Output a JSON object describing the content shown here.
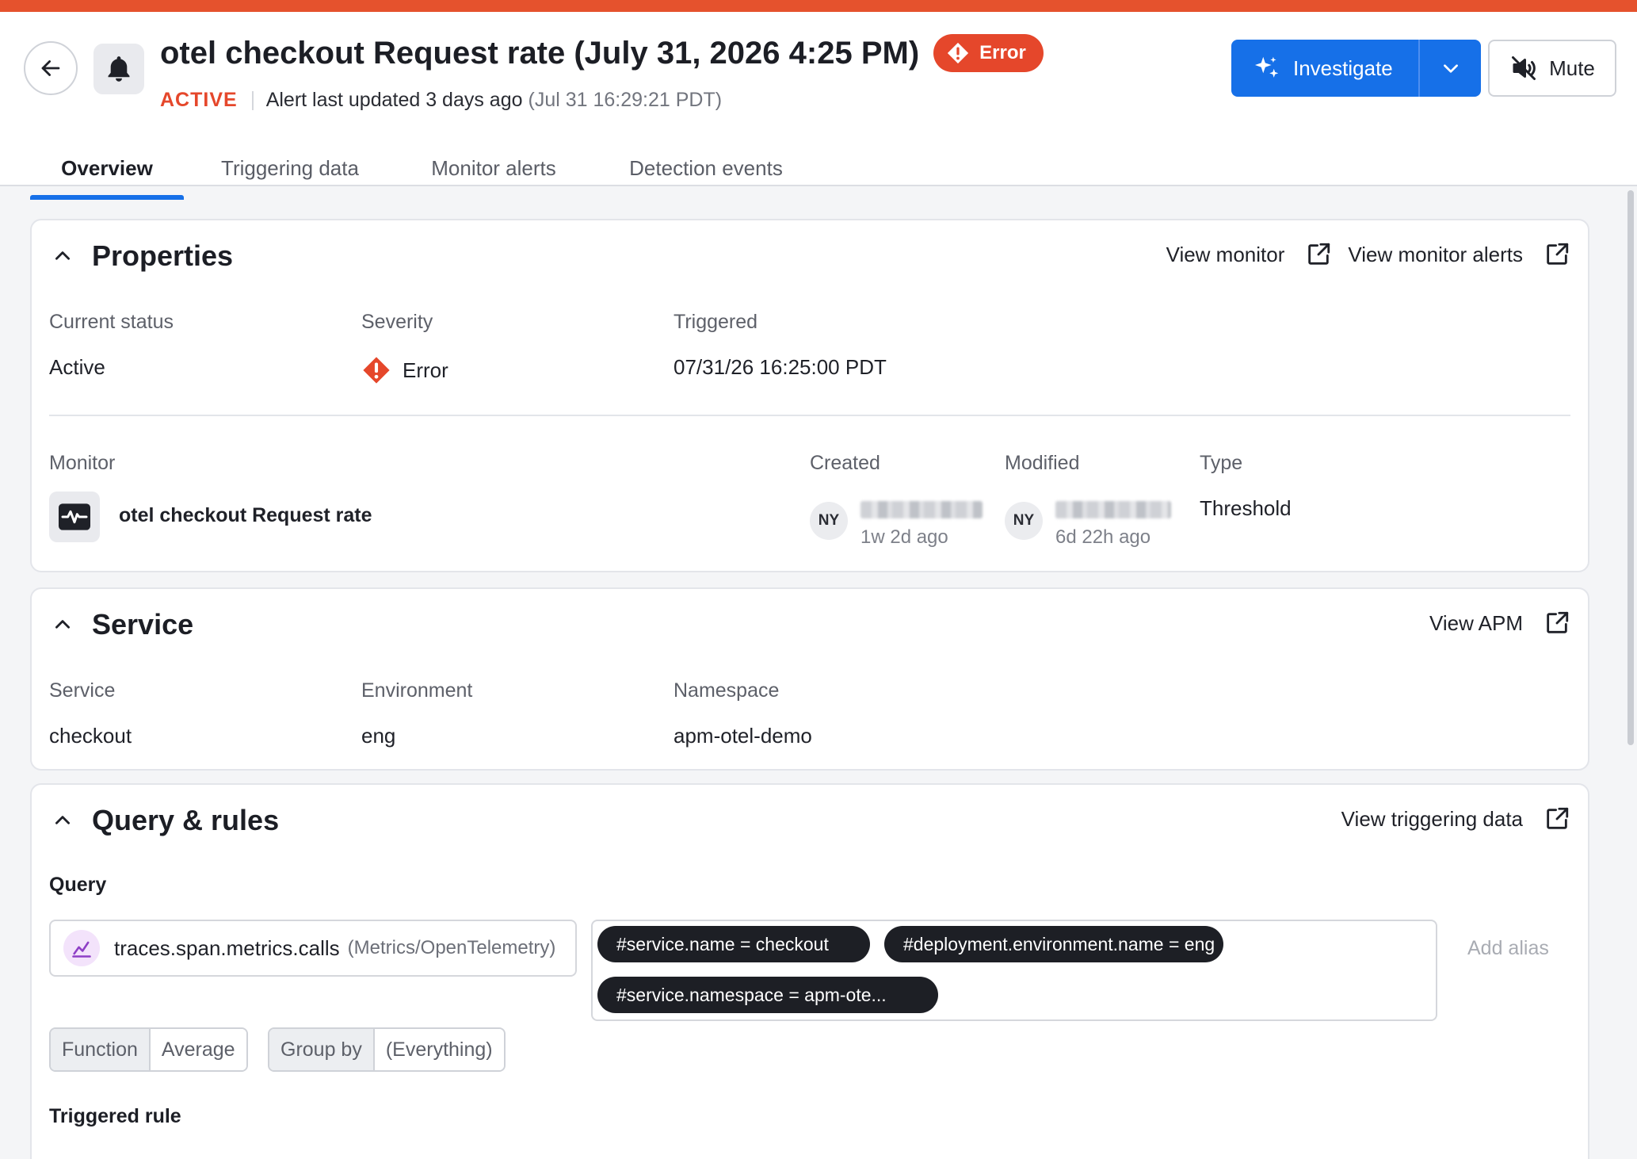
{
  "header": {
    "title": "otel checkout Request rate (July 31, 2026 4:25 PM)",
    "severity_badge": "Error",
    "status": "ACTIVE",
    "updated_text": "Alert last updated 3 days ago",
    "updated_time": "(Jul 31 16:29:21 PDT)",
    "investigate_label": "Investigate",
    "mute_label": "Mute",
    "accent_color": "#e5522d",
    "primary_color": "#1670e8"
  },
  "tabs": [
    "Overview",
    "Triggering data",
    "Monitor alerts",
    "Detection events"
  ],
  "properties": {
    "title": "Properties",
    "link_view_monitor": "View monitor",
    "link_view_monitor_alerts": "View monitor alerts",
    "current_status_label": "Current status",
    "current_status_value": "Active",
    "severity_label": "Severity",
    "severity_value": "Error",
    "triggered_label": "Triggered",
    "triggered_value": "07/31/26 16:25:00 PDT",
    "monitor_label": "Monitor",
    "monitor_name": "otel checkout Request rate",
    "created_label": "Created",
    "created_initials": "NY",
    "created_ago": "1w 2d ago",
    "modified_label": "Modified",
    "modified_initials": "NY",
    "modified_ago": "6d 22h ago",
    "type_label": "Type",
    "type_value": "Threshold"
  },
  "service": {
    "title": "Service",
    "link_view_apm": "View APM",
    "service_label": "Service",
    "service_value": "checkout",
    "environment_label": "Environment",
    "environment_value": "eng",
    "namespace_label": "Namespace",
    "namespace_value": "apm-otel-demo"
  },
  "query_rules": {
    "title": "Query & rules",
    "link_view_triggering_data": "View triggering data",
    "query_label": "Query",
    "metric_name": "traces.span.metrics.calls",
    "metric_source": "(Metrics/OpenTelemetry)",
    "filters": [
      "#service.name = checkout",
      "#deployment.environment.name = eng",
      "#service.namespace = apm-ote..."
    ],
    "add_alias": "Add alias",
    "function_key": "Function",
    "function_value": "Average",
    "group_by_key": "Group by",
    "group_by_value": "(Everything)",
    "triggered_rule_label": "Triggered rule"
  }
}
